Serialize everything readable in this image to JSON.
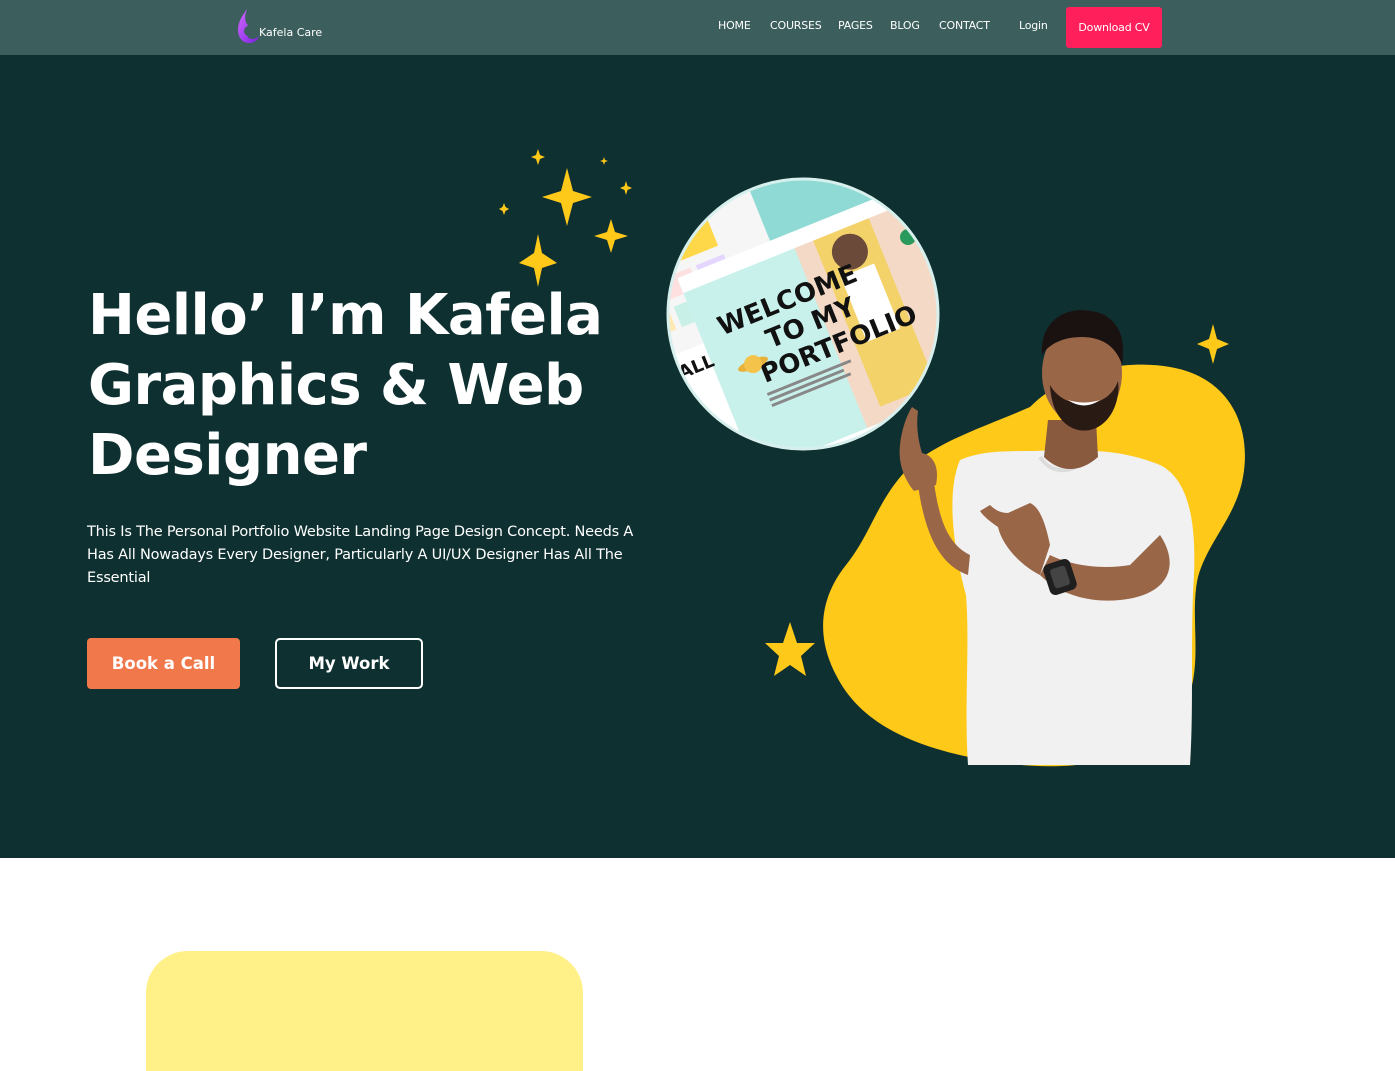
{
  "nav": {
    "brand": "Kafela Care",
    "links": [
      "HOME",
      "COURSES",
      "PAGES",
      "BLOG",
      "CONTACT"
    ],
    "login": "Login",
    "cta": "Download CV"
  },
  "hero": {
    "title_lines": [
      "Hello’ I’m Kafela",
      "Graphics & Web",
      "Designer"
    ],
    "description": "This Is The Personal Portfolio Website Landing Page Design Concept. Needs A Has All Nowadays Every Designer, Particularly A UI/UX Designer Has All The Essential",
    "primary_button": "Book a Call",
    "secondary_button": "My Work",
    "portfolio_lines": [
      "WELCOME",
      "TO MY",
      "PORTFOLIO"
    ],
    "portfolio_side_text": "ALL"
  },
  "colors": {
    "nav_bg": "#3c5f5e",
    "hero_bg": "#0f3030",
    "cta_pink": "#ff1f5a",
    "accent_orange": "#f1784a",
    "accent_yellow": "#ffc919",
    "card_yellow": "#fff088"
  }
}
